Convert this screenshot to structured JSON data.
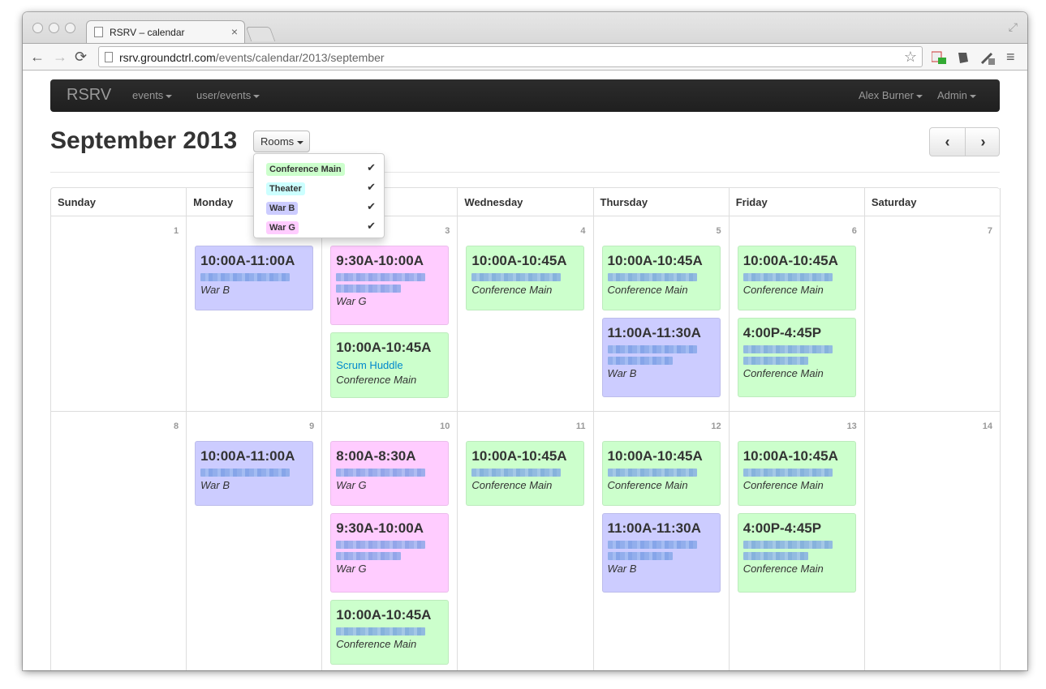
{
  "browser": {
    "tab_title": "RSRV – calendar",
    "tab_close": "×",
    "url_host": "rsrv.groundctrl.com",
    "url_path": "/events/calendar/2013/september",
    "back": "←",
    "forward": "→",
    "reload": "⟳",
    "star": "☆",
    "menu": "≡"
  },
  "navbar": {
    "brand": "RSRV",
    "items": [
      "events",
      "user/events"
    ],
    "right_items": [
      "Alex Burner",
      "Admin"
    ]
  },
  "header": {
    "title": "September 2013",
    "rooms_button": "Rooms",
    "prev": "‹",
    "next": "›"
  },
  "rooms_dropdown": [
    {
      "label": "Conference Main",
      "color": "#ccffcc",
      "check": "✔"
    },
    {
      "label": "Theater",
      "color": "#ccffff",
      "check": "✔"
    },
    {
      "label": "War B",
      "color": "#ccccff",
      "check": "✔"
    },
    {
      "label": "War G",
      "color": "#ffccff",
      "check": "✔"
    }
  ],
  "room_colors": {
    "Conference Main": "#ccffcc",
    "Theater": "#ccffff",
    "War B": "#ccccff",
    "War G": "#ffccff"
  },
  "weekdays": [
    "Sunday",
    "Monday",
    "Tuesday",
    "Wednesday",
    "Thursday",
    "Friday",
    "Saturday"
  ],
  "weeks": [
    {
      "days": [
        {
          "num": "1",
          "events": []
        },
        {
          "num": "2",
          "events": [
            {
              "time": "10:00A-11:00A",
              "title": "",
              "room": "War B"
            }
          ]
        },
        {
          "num": "3",
          "events": [
            {
              "time": "9:30A-10:00A",
              "title": "",
              "room": "War G"
            },
            {
              "time": "10:00A-10:45A",
              "title": "Scrum Huddle",
              "room": "Conference Main"
            }
          ]
        },
        {
          "num": "4",
          "events": [
            {
              "time": "10:00A-10:45A",
              "title": "",
              "room": "Conference Main"
            }
          ]
        },
        {
          "num": "5",
          "events": [
            {
              "time": "10:00A-10:45A",
              "title": "",
              "room": "Conference Main"
            },
            {
              "time": "11:00A-11:30A",
              "title": "",
              "room": "War B"
            }
          ]
        },
        {
          "num": "6",
          "events": [
            {
              "time": "10:00A-10:45A",
              "title": "",
              "room": "Conference Main"
            },
            {
              "time": "4:00P-4:45P",
              "title": "",
              "room": "Conference Main"
            }
          ]
        },
        {
          "num": "7",
          "events": []
        }
      ]
    },
    {
      "days": [
        {
          "num": "8",
          "events": []
        },
        {
          "num": "9",
          "events": [
            {
              "time": "10:00A-11:00A",
              "title": "",
              "room": "War B"
            }
          ]
        },
        {
          "num": "10",
          "events": [
            {
              "time": "8:00A-8:30A",
              "title": "",
              "room": "War G"
            },
            {
              "time": "9:30A-10:00A",
              "title": "",
              "room": "War G"
            },
            {
              "time": "10:00A-10:45A",
              "title": "",
              "room": "Conference Main"
            }
          ]
        },
        {
          "num": "11",
          "events": [
            {
              "time": "10:00A-10:45A",
              "title": "",
              "room": "Conference Main"
            }
          ]
        },
        {
          "num": "12",
          "events": [
            {
              "time": "10:00A-10:45A",
              "title": "",
              "room": "Conference Main"
            },
            {
              "time": "11:00A-11:30A",
              "title": "",
              "room": "War B"
            }
          ]
        },
        {
          "num": "13",
          "events": [
            {
              "time": "10:00A-10:45A",
              "title": "",
              "room": "Conference Main"
            },
            {
              "time": "4:00P-4:45P",
              "title": "",
              "room": "Conference Main"
            }
          ]
        },
        {
          "num": "14",
          "events": []
        }
      ]
    }
  ]
}
